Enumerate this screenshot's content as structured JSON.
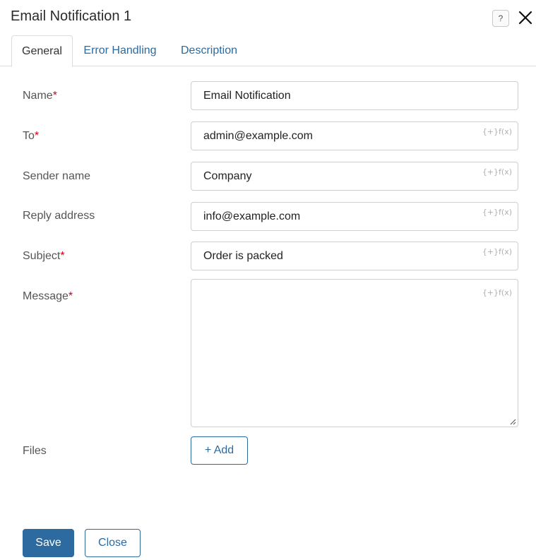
{
  "dialog": {
    "title": "Email Notification 1",
    "help_label": "?"
  },
  "tabs": [
    {
      "label": "General",
      "active": true
    },
    {
      "label": "Error Handling",
      "active": false
    },
    {
      "label": "Description",
      "active": false
    }
  ],
  "form": {
    "required_mark": "*",
    "variable_badge": "{+}f(x)",
    "name": {
      "label": "Name",
      "value": "Email Notification"
    },
    "to": {
      "label": "To",
      "value": "admin@example.com"
    },
    "sender_name": {
      "label": "Sender name",
      "value": "Company"
    },
    "reply_address": {
      "label": "Reply address",
      "value": "info@example.com"
    },
    "subject": {
      "label": "Subject",
      "value": "Order is packed"
    },
    "message": {
      "label": "Message",
      "value": ""
    },
    "files": {
      "label": "Files",
      "add_label": "+ Add"
    }
  },
  "footer": {
    "save_label": "Save",
    "close_label": "Close"
  },
  "colors": {
    "accent": "#2c6aa0",
    "required": "#d0021b"
  }
}
